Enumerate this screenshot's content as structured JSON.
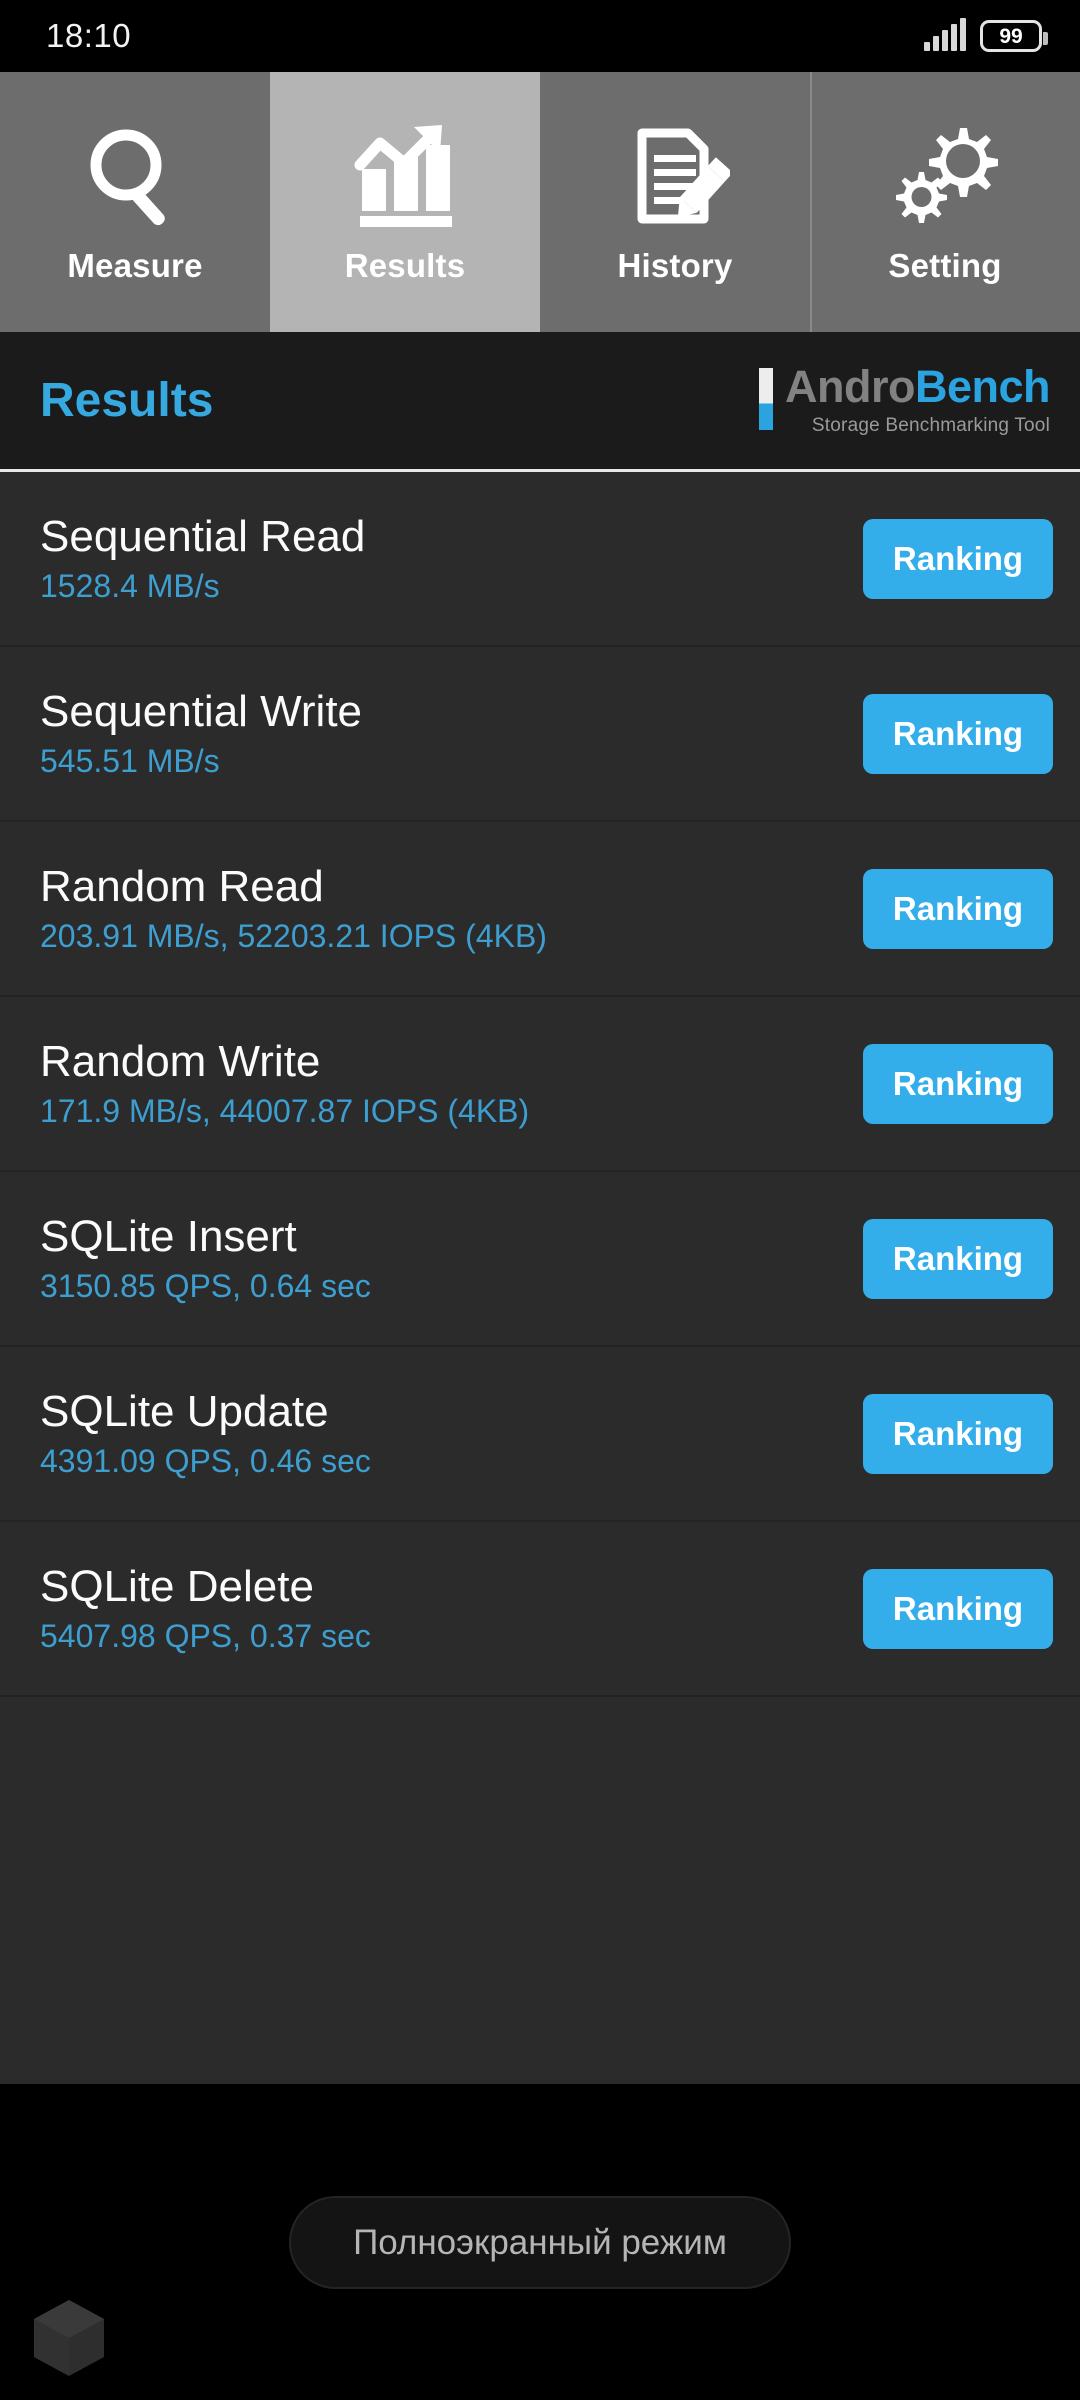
{
  "status_bar": {
    "time": "18:10",
    "signal_icon": "signal-bars-icon",
    "battery_level": "99"
  },
  "tabs": [
    {
      "label": "Measure",
      "icon": "magnifier-icon",
      "active": false
    },
    {
      "label": "Results",
      "icon": "bar-chart-arrow-icon",
      "active": true
    },
    {
      "label": "History",
      "icon": "document-pencil-icon",
      "active": false
    },
    {
      "label": "Setting",
      "icon": "gears-icon",
      "active": false
    }
  ],
  "header": {
    "title": "Results",
    "logo_andro": "Andro",
    "logo_bench": "Bench",
    "logo_subtitle": "Storage Benchmarking Tool"
  },
  "results": [
    {
      "title": "Sequential Read",
      "value": "1528.4 MB/s",
      "button": "Ranking"
    },
    {
      "title": "Sequential Write",
      "value": "545.51 MB/s",
      "button": "Ranking"
    },
    {
      "title": "Random Read",
      "value": "203.91 MB/s, 52203.21 IOPS (4KB)",
      "button": "Ranking"
    },
    {
      "title": "Random Write",
      "value": "171.9 MB/s, 44007.87 IOPS (4KB)",
      "button": "Ranking"
    },
    {
      "title": "SQLite Insert",
      "value": "3150.85 QPS, 0.64 sec",
      "button": "Ranking"
    },
    {
      "title": "SQLite Update",
      "value": "4391.09 QPS, 0.46 sec",
      "button": "Ranking"
    },
    {
      "title": "SQLite Delete",
      "value": "5407.98 QPS, 0.37 sec",
      "button": "Ranking"
    }
  ],
  "bottom": {
    "fullscreen_label": "Полноэкранный режим",
    "corner_icon": "hexagon-cube-icon"
  },
  "colors": {
    "accent_blue": "#33aeea",
    "value_blue": "#3d9ed0",
    "title_blue": "#36a9e1",
    "tab_inactive": "#6d6d6d",
    "tab_active": "#b4b4b4",
    "header_bg": "#1b1b1b",
    "list_bg": "#2b2b2b"
  }
}
